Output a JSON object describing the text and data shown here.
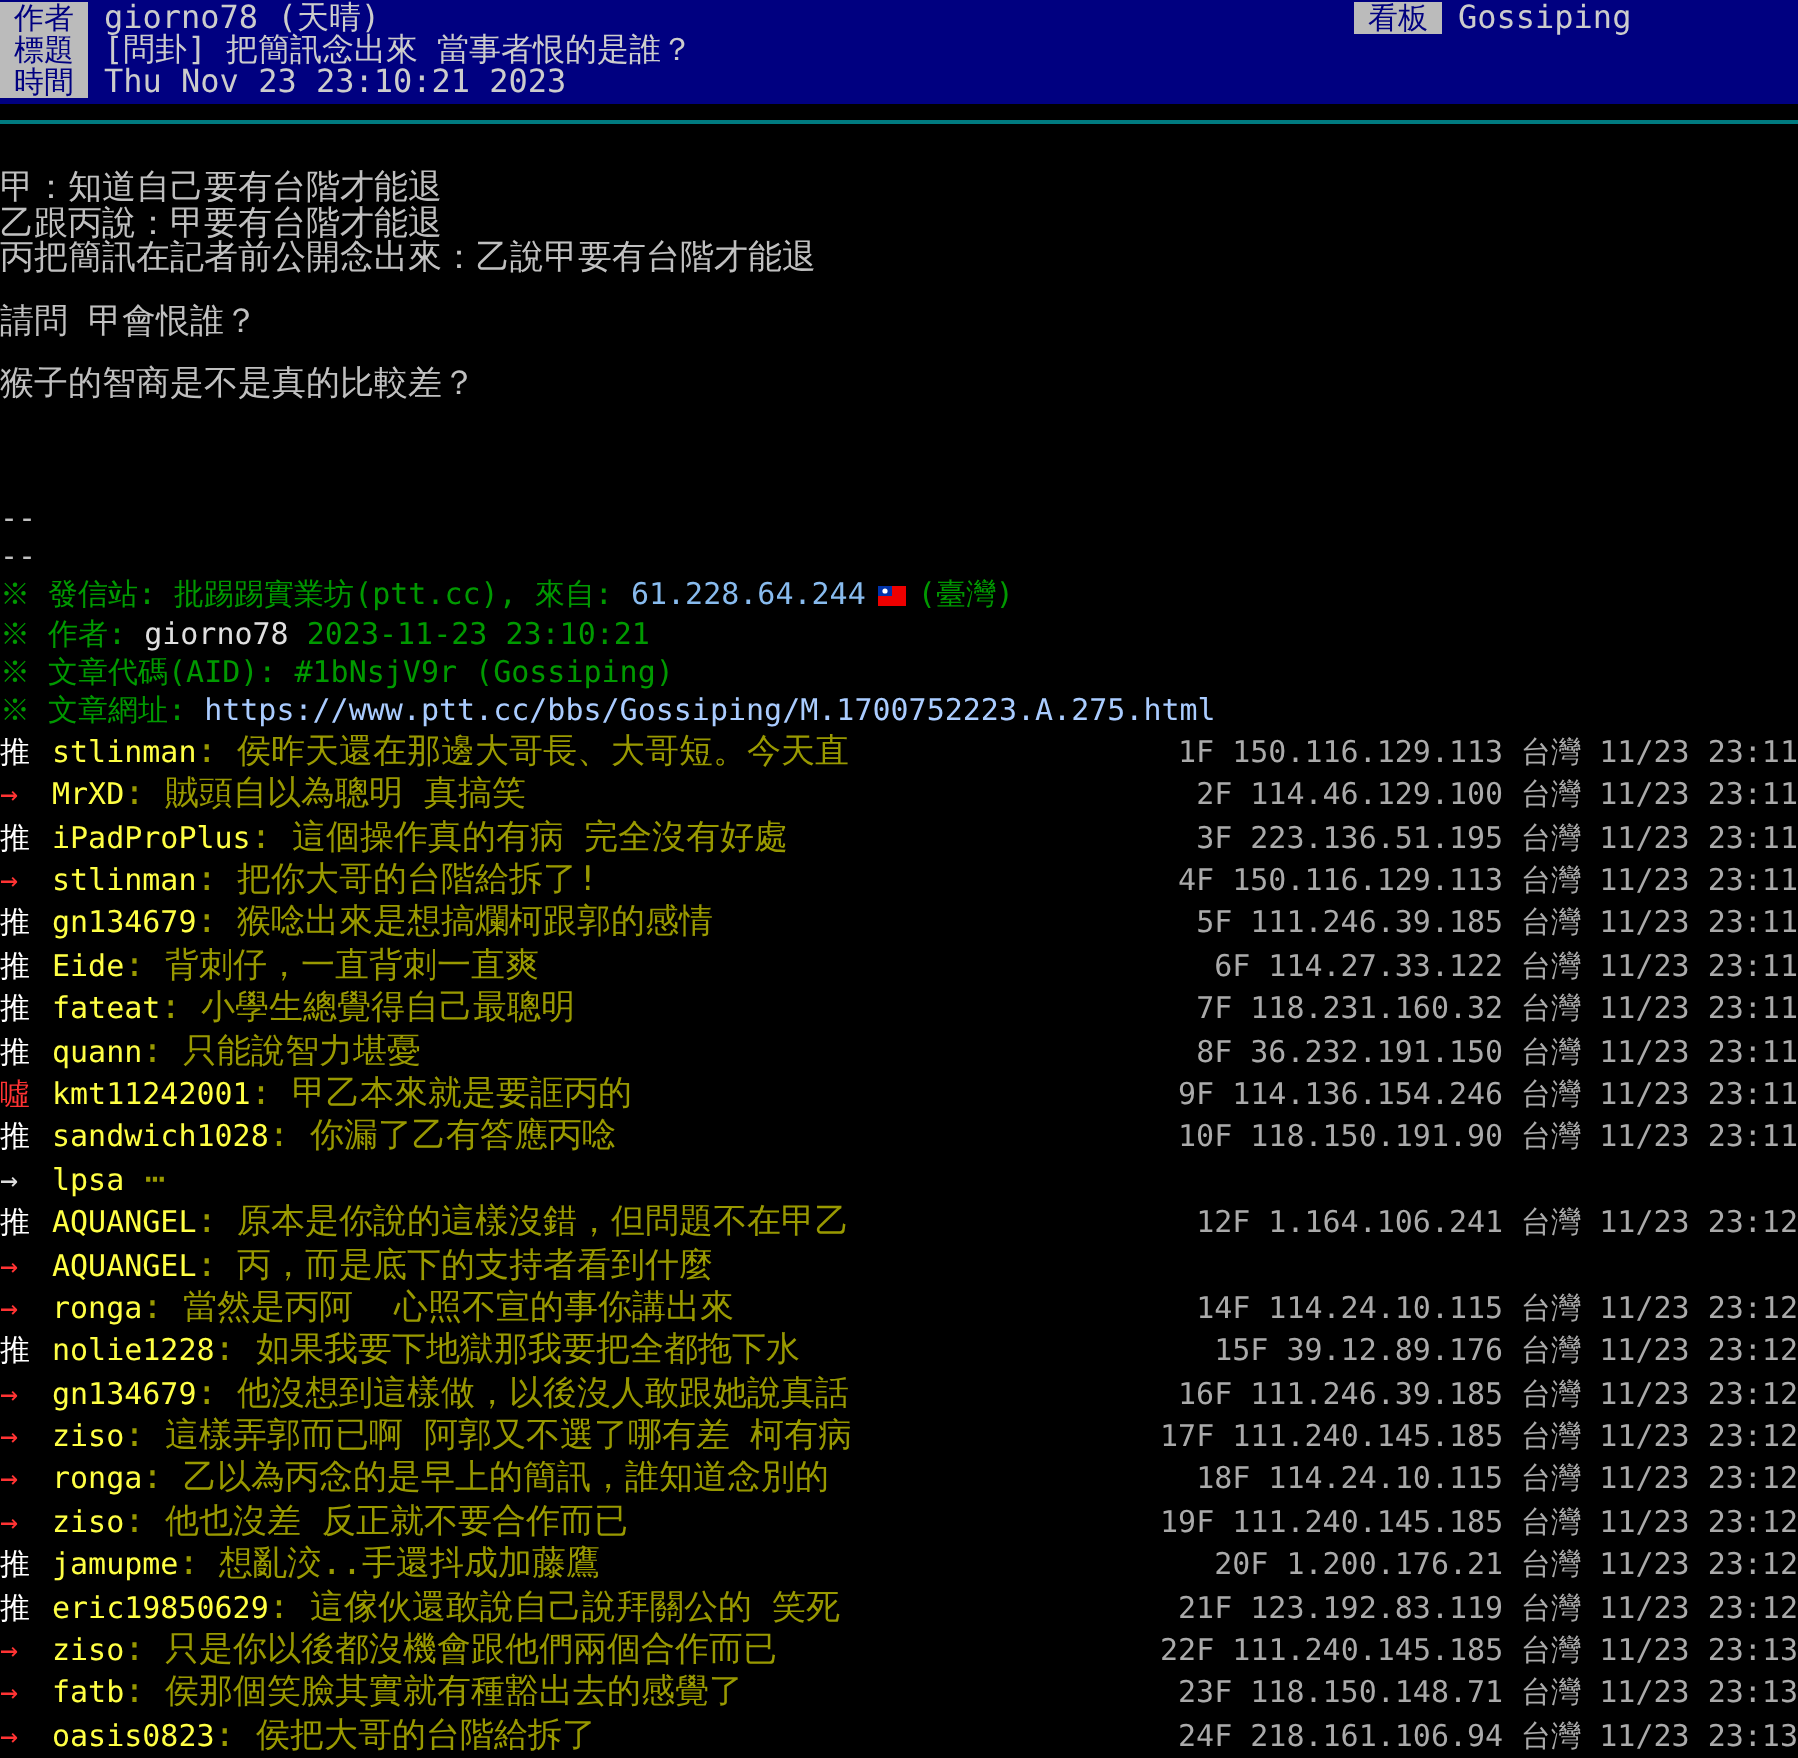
{
  "header": {
    "author": {
      "label": "作者",
      "value": "giorno78 (天晴)"
    },
    "board": {
      "label": "看板",
      "value": "Gossiping"
    },
    "title": {
      "label": "標題",
      "value": "[問卦] 把簡訊念出來 當事者恨的是誰？"
    },
    "time": {
      "label": "時間",
      "value": "Thu Nov 23 23:10:21 2023"
    }
  },
  "body": [
    [
      "甲：知道自己要有台階才能退",
      "乙跟丙說：甲要有台階才能退",
      "丙把簡訊在記者前公開念出來：乙說甲要有台階才能退"
    ],
    [
      "請問 甲會恨誰？"
    ],
    [
      "猴子的智商是不是真的比較差？"
    ]
  ],
  "separators": [
    "--",
    "--"
  ],
  "signature": [
    {
      "kind": "origin",
      "label": "※ 發信站: 批踢踢實業坊(ptt.cc), 來自: ",
      "value": "61.228.64.244",
      "suffix": "(臺灣)"
    },
    {
      "kind": "author",
      "label": "※ 作者: ",
      "value": "giorno78",
      "suffix": "2023-11-23 23:10:21"
    },
    {
      "kind": "aid",
      "label": "※ 文章代碼(AID): #1bNsjV9r (Gossiping)"
    },
    {
      "kind": "url",
      "label": "※ 文章網址: ",
      "value": "https://www.ptt.cc/bbs/Gossiping/M.1700752223.A.275.html"
    }
  ],
  "comments": [
    {
      "kind": "push",
      "tag": "推",
      "user": "stlinman",
      "content": ": 侯昨天還在那邊大哥長、大哥短。今天直",
      "meta": "1F 150.116.129.113 台灣 11/23 23:11"
    },
    {
      "kind": "arrow",
      "tag": "→",
      "user": "MrXD",
      "content": ": 賊頭自以為聰明 真搞笑",
      "meta": "2F 114.46.129.100 台灣 11/23 23:11"
    },
    {
      "kind": "push",
      "tag": "推",
      "user": "iPadProPlus",
      "content": ": 這個操作真的有病 完全沒有好處",
      "meta": "3F 223.136.51.195 台灣 11/23 23:11"
    },
    {
      "kind": "arrow",
      "tag": "→",
      "user": "stlinman",
      "content": ": 把你大哥的台階給拆了!",
      "meta": "4F 150.116.129.113 台灣 11/23 23:11"
    },
    {
      "kind": "push",
      "tag": "推",
      "user": "gn134679",
      "content": ": 猴唸出來是想搞爛柯跟郭的感情",
      "meta": "5F 111.246.39.185 台灣 11/23 23:11"
    },
    {
      "kind": "push",
      "tag": "推",
      "user": "Eide",
      "content": ": 背刺仔，一直背刺一直爽",
      "meta": "6F 114.27.33.122 台灣 11/23 23:11"
    },
    {
      "kind": "push",
      "tag": "推",
      "user": "fateat",
      "content": ": 小學生總覺得自己最聰明",
      "meta": "7F 118.231.160.32 台灣 11/23 23:11"
    },
    {
      "kind": "push",
      "tag": "推",
      "user": "quann",
      "content": ": 只能說智力堪憂",
      "meta": "8F 36.232.191.150 台灣 11/23 23:11"
    },
    {
      "kind": "boo",
      "tag": "噓",
      "user": "kmt11242001",
      "content": ": 甲乙本來就是要誆丙的",
      "meta": "9F 114.136.154.246 台灣 11/23 23:11"
    },
    {
      "kind": "push",
      "tag": "推",
      "user": "sandwich1028",
      "content": ": 你漏了乙有答應丙唸",
      "meta": "10F 118.150.191.90 台灣 11/23 23:11"
    },
    {
      "kind": "folded",
      "tag": "→",
      "user": "lpsa",
      "content": " ⋯"
    },
    {
      "kind": "push",
      "tag": "推",
      "user": "AQUANGEL",
      "content": ": 原本是你說的這樣沒錯，但問題不在甲乙",
      "meta": "12F 1.164.106.241 台灣 11/23 23:12"
    },
    {
      "kind": "arrow",
      "tag": "→",
      "user": "AQUANGEL",
      "content": ": 丙，而是底下的支持者看到什麼"
    },
    {
      "kind": "arrow",
      "tag": "→",
      "user": "ronga",
      "content": ": 當然是丙阿  心照不宣的事你講出來",
      "meta": "14F 114.24.10.115 台灣 11/23 23:12"
    },
    {
      "kind": "push",
      "tag": "推",
      "user": "nolie1228",
      "content": ": 如果我要下地獄那我要把全都拖下水",
      "meta": "15F 39.12.89.176 台灣 11/23 23:12"
    },
    {
      "kind": "arrow",
      "tag": "→",
      "user": "gn134679",
      "content": ": 他沒想到這樣做，以後沒人敢跟她說真話",
      "meta": "16F 111.246.39.185 台灣 11/23 23:12"
    },
    {
      "kind": "arrow",
      "tag": "→",
      "user": "ziso",
      "content": ": 這樣弄郭而已啊 阿郭又不選了哪有差 柯有病",
      "meta": "17F 111.240.145.185 台灣 11/23 23:12"
    },
    {
      "kind": "arrow",
      "tag": "→",
      "user": "ronga",
      "content": ": 乙以為丙念的是早上的簡訊，誰知道念別的",
      "meta": "18F 114.24.10.115 台灣 11/23 23:12"
    },
    {
      "kind": "arrow",
      "tag": "→",
      "user": "ziso",
      "content": ": 他也沒差 反正就不要合作而已",
      "meta": "19F 111.240.145.185 台灣 11/23 23:12"
    },
    {
      "kind": "push",
      "tag": "推",
      "user": "jamupme",
      "content": ": 想亂洨..手還抖成加藤鷹",
      "meta": "20F 1.200.176.21 台灣 11/23 23:12"
    },
    {
      "kind": "push",
      "tag": "推",
      "user": "eric19850629",
      "content": ": 這傢伙還敢說自己說拜關公的 笑死",
      "meta": "21F 123.192.83.119 台灣 11/23 23:12"
    },
    {
      "kind": "arrow",
      "tag": "→",
      "user": "ziso",
      "content": ": 只是你以後都沒機會跟他們兩個合作而已",
      "meta": "22F 111.240.145.185 台灣 11/23 23:13"
    },
    {
      "kind": "arrow",
      "tag": "→",
      "user": "fatb",
      "content": ": 侯那個笑臉其實就有種豁出去的感覺了",
      "meta": "23F 118.150.148.71 台灣 11/23 23:13"
    },
    {
      "kind": "arrow",
      "tag": "→",
      "user": "oasis0823",
      "content": ": 侯把大哥的台階給拆了",
      "meta": "24F 218.161.106.94 台灣 11/23 23:13"
    }
  ]
}
